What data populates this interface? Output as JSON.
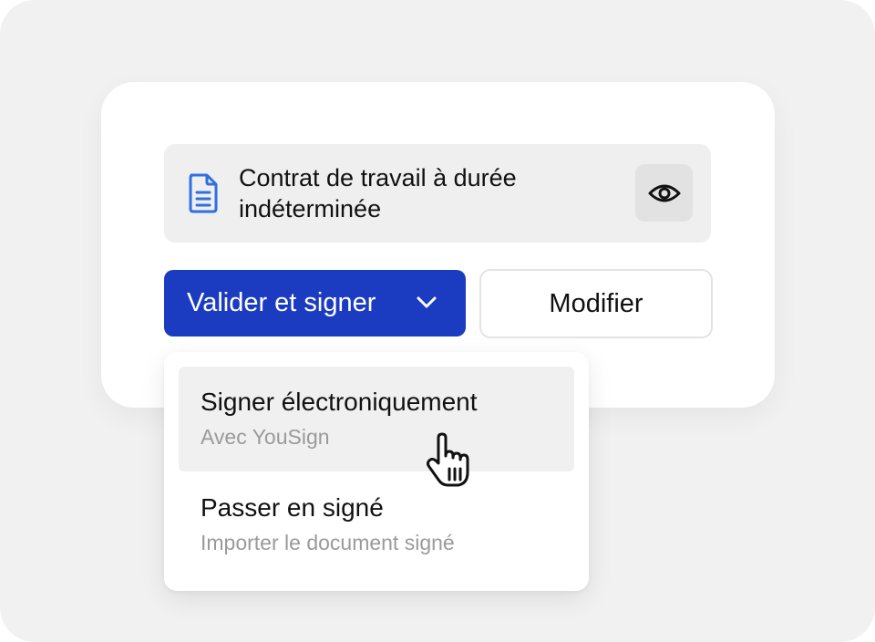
{
  "document": {
    "title": "Contrat de travail à durée indéterminée",
    "icon": "document-icon",
    "icon_color": "#2f6fe0",
    "view_icon": "eye-icon"
  },
  "actions": {
    "primary_label": "Valider et signer",
    "primary_color": "#1b3cc1",
    "primary_icon": "chevron-down-icon",
    "secondary_label": "Modifier"
  },
  "menu": {
    "items": [
      {
        "title": "Signer électroniquement",
        "subtitle": "Avec YouSign",
        "hovered": true
      },
      {
        "title": "Passer en signé",
        "subtitle": "Importer le document signé",
        "hovered": false
      }
    ]
  },
  "cursor": {
    "icon": "hand-pointer-icon"
  }
}
